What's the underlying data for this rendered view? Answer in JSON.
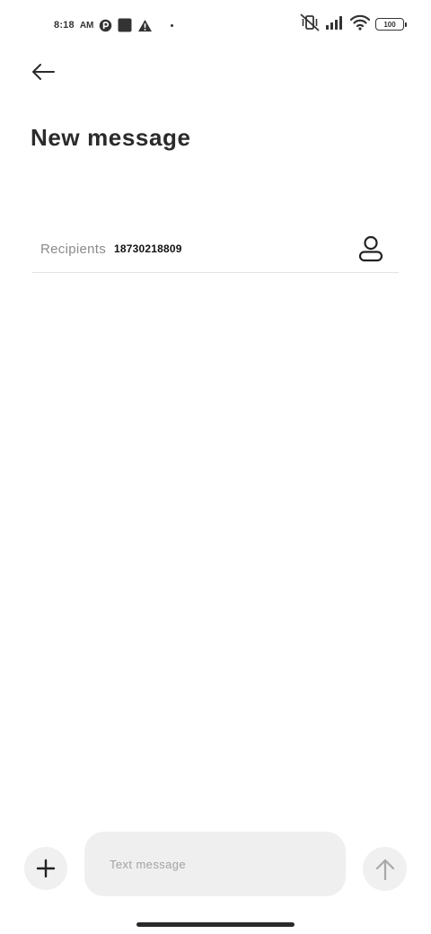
{
  "status_bar": {
    "time": "8:18",
    "ampm": "AM",
    "left_icons": [
      "app-notification-icon",
      "square-app-icon",
      "warning-icon",
      "more-notifications-dot"
    ],
    "right_icons": [
      "vibrate-off-icon",
      "signal-icon",
      "wifi-icon",
      "battery-icon"
    ],
    "battery_level": "100"
  },
  "header": {
    "back_icon": "arrow-left-icon",
    "title": "New message"
  },
  "recipient": {
    "label": "Recipients",
    "value": "18730218809",
    "contact_icon": "contact-person-icon"
  },
  "composer": {
    "add_icon": "plus-icon",
    "placeholder": "Text message",
    "value": "",
    "send_icon": "arrow-up-icon"
  },
  "colors": {
    "text_primary": "#2b2b2b",
    "text_secondary": "#8a8a8a",
    "control_bg": "#efefef",
    "divider": "#e2e2e2"
  }
}
